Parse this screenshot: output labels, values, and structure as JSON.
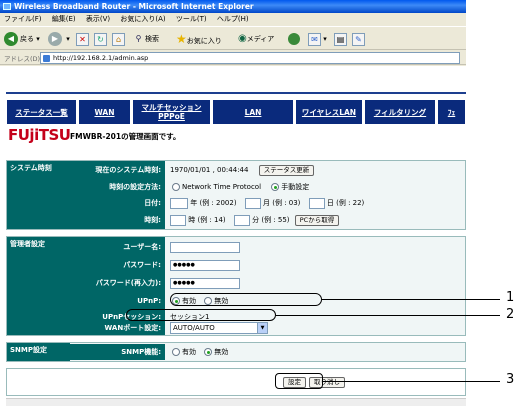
{
  "window": {
    "title": "Wireless Broadband Router - Microsoft Internet Explorer"
  },
  "menu": [
    "ファイル(F)",
    "編集(E)",
    "表示(V)",
    "お気に入り(A)",
    "ツール(T)",
    "ヘルプ(H)"
  ],
  "toolbar": {
    "back": "戻る",
    "search": "検索",
    "favorites": "お気に入り",
    "media": "メディア"
  },
  "address": {
    "label": "アドレス(D)",
    "url": "http://192.168.2.1/admin.asp"
  },
  "nav": [
    {
      "label": "ステータス一覧"
    },
    {
      "label": "WAN"
    },
    {
      "label": "マルチセッションPPPoE"
    },
    {
      "label": "LAN"
    },
    {
      "label": "ワイヤレスLAN"
    },
    {
      "label": "フィルタリング"
    },
    {
      "label": "ﾌｪ"
    }
  ],
  "brand": {
    "logo": "FUjiTSU",
    "title": "FMWBR-201の管理画面です。"
  },
  "system_time": {
    "section": "システム時刻",
    "current_label": "現在のシステム時刻:",
    "current_value": "1970/01/01 , 00:44:44",
    "status_button": "ステータス更新",
    "method_label": "時刻の設定方法:",
    "ntp": "Network Time Protocol",
    "manual": "手動設定",
    "date_label": "日付:",
    "year_hint": "年 (例 : 2002)",
    "month_hint": "月 (例 : 03)",
    "day_hint": "日 (例 : 22)",
    "time_label": "時刻:",
    "hour_hint": "時 (例 : 14)",
    "minute_hint": "分 (例 : 55)",
    "pc_button": "PCから取得"
  },
  "admin": {
    "section": "管理者設定",
    "user_label": "ユーザー名:",
    "pass_label": "パスワード:",
    "pass_value": "●●●●●",
    "pass2_label": "パスワード(再入力):",
    "pass2_value": "●●●●●",
    "upnp_label": "UPnP:",
    "enable": "有効",
    "disable": "無効",
    "upnp_session_label": "UPnPセッション:",
    "upnp_session_value": "セッション1",
    "wan_port_label": "WANポート設定:",
    "wan_port_value": "AUTO/AUTO"
  },
  "snmp": {
    "section": "SNMP設定",
    "label": "SNMP機能:",
    "enable": "有効",
    "disable": "無効"
  },
  "footer": {
    "apply": "設定",
    "cancel": "取り消し"
  },
  "callouts": [
    "1",
    "2",
    "3"
  ]
}
